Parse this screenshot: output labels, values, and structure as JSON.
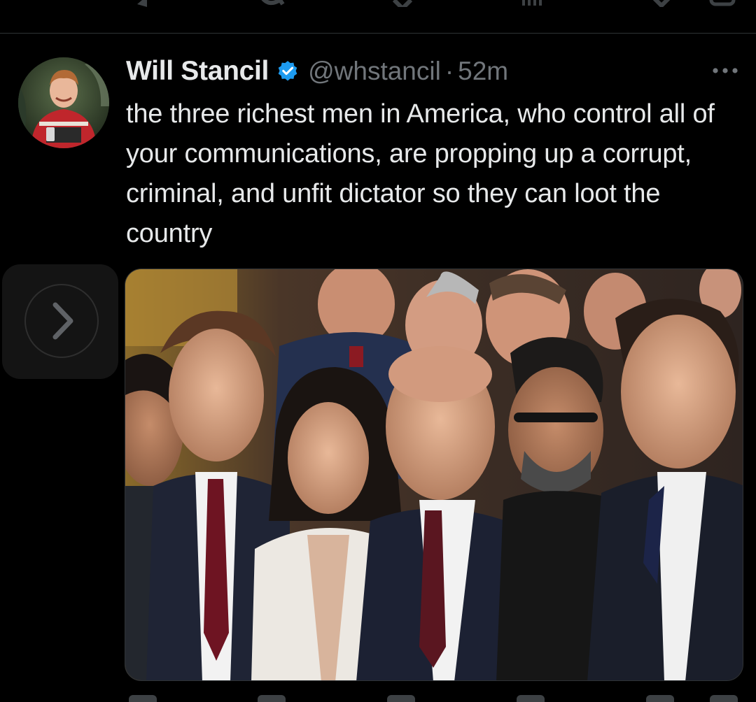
{
  "tweet": {
    "author_name": "Will Stancil",
    "handle": "@whstancil",
    "separator": "·",
    "time": "52m",
    "text": "the three richest men in America, who control all of your communications, are propping up a corrupt, criminal, and unfit dictator so they can loot the country",
    "verified_icon": "verified-badge-icon",
    "more_icon": "more-options-icon"
  },
  "nav": {
    "next_icon": "chevron-right-icon"
  },
  "colors": {
    "background": "#000000",
    "text": "#e7e9ea",
    "muted": "#71767b",
    "verified": "#1d9bf0",
    "divider": "#2f3336"
  },
  "prev_actions": [
    "reply-icon",
    "retweet-icon",
    "like-icon",
    "views-icon",
    "bookmark-icon",
    "share-icon"
  ],
  "bottom_actions": [
    "reply-icon",
    "retweet-icon",
    "like-icon",
    "views-icon",
    "bookmark-icon",
    "share-icon"
  ]
}
